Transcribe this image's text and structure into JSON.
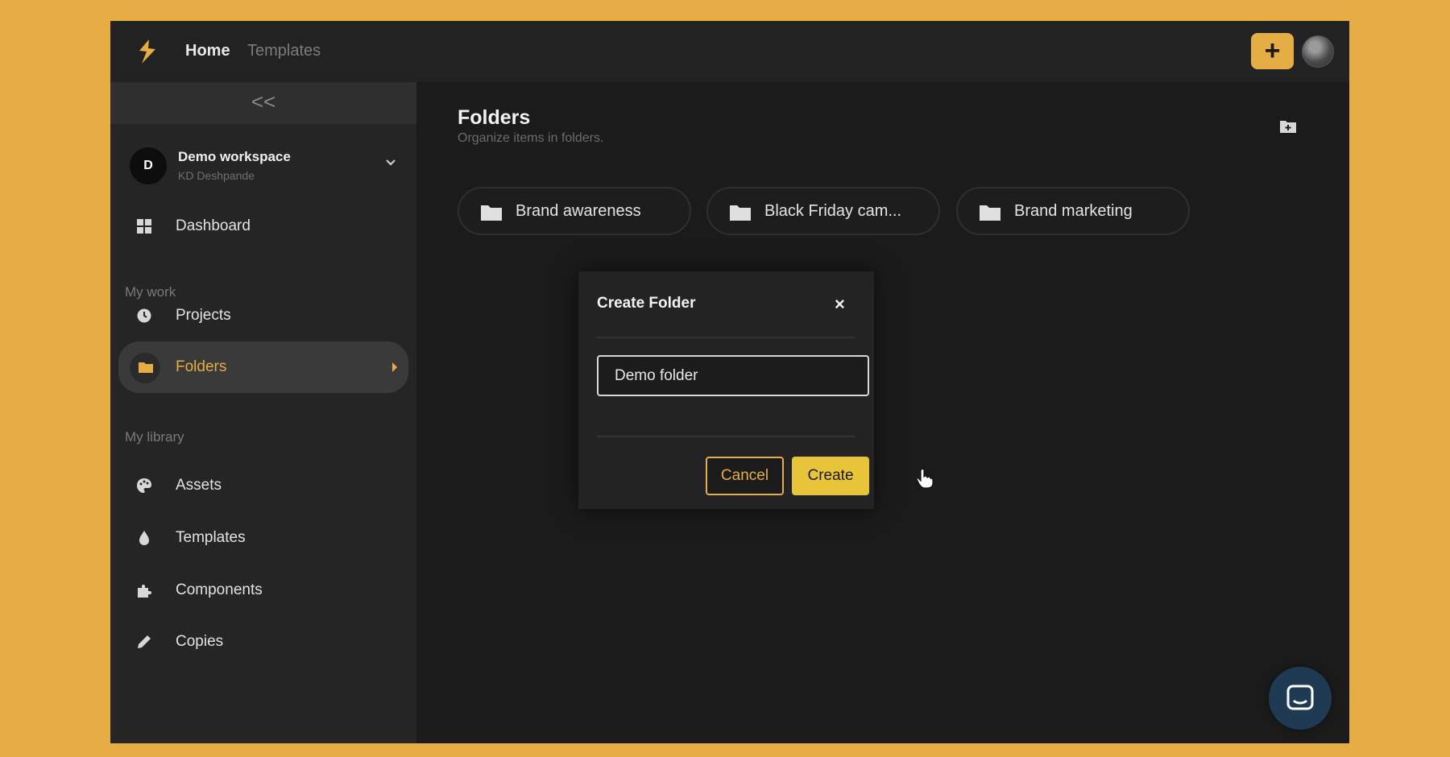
{
  "topbar": {
    "nav": [
      {
        "label": "Home",
        "active": true
      },
      {
        "label": "Templates",
        "active": false
      }
    ],
    "add_button_label": "+"
  },
  "sidebar": {
    "collapse_label": "<<",
    "workspace": {
      "initial": "D",
      "name": "Demo workspace",
      "owner": "KD Deshpande"
    },
    "dashboard_label": "Dashboard",
    "sections": [
      {
        "title": "My work",
        "items": [
          {
            "label": "Projects",
            "icon": "clock-icon"
          },
          {
            "label": "Folders",
            "icon": "folder-icon",
            "active": true
          }
        ]
      },
      {
        "title": "My library",
        "items": [
          {
            "label": "Assets",
            "icon": "palette-icon"
          },
          {
            "label": "Templates",
            "icon": "drop-icon"
          },
          {
            "label": "Components",
            "icon": "puzzle-icon"
          },
          {
            "label": "Copies",
            "icon": "pencil-icon"
          }
        ]
      }
    ]
  },
  "main": {
    "title": "Folders",
    "subtitle": "Organize items in folders.",
    "folders": [
      "Brand awareness",
      "Black Friday cam...",
      "Brand marketing"
    ]
  },
  "dialog": {
    "title": "Create Folder",
    "close_label": "×",
    "input_value": "Demo folder",
    "cancel_label": "Cancel",
    "create_label": "Create"
  },
  "colors": {
    "accent": "#e7ad45",
    "background": "#1b1b1b",
    "sidebar": "#252525",
    "create_button": "#e7c438"
  }
}
